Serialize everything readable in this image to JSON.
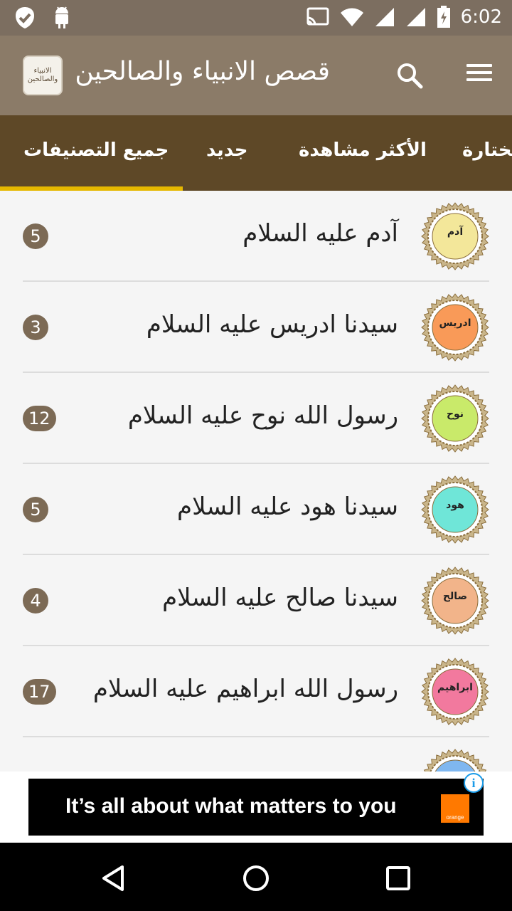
{
  "status_bar": {
    "time": "6:02",
    "left_icons": [
      "check-shield-icon",
      "android-icon"
    ],
    "right_icons": [
      "cast-icon",
      "wifi-icon",
      "signal-icon",
      "signal-icon-2",
      "battery-icon"
    ]
  },
  "toolbar": {
    "title": "قصص الانبياء والصالحين",
    "app_icon_text": "الانبياء والصالحين",
    "background": "#8b7b68"
  },
  "tabs": [
    {
      "label": "جميع التصنيفات",
      "selected": true
    },
    {
      "label": "جديد",
      "selected": false
    },
    {
      "label": "الأكثر مشاهدة",
      "selected": false
    },
    {
      "label": "مختارة",
      "selected": false
    }
  ],
  "colors": {
    "tab_bar": "#5e4827",
    "tab_indicator": "#e6b800",
    "badge": "#7c6a55"
  },
  "list": {
    "items": [
      {
        "label": "آدم عليه السلام",
        "count": "5",
        "medallion": "آدم",
        "color": "#f3e79a"
      },
      {
        "label": "سيدنا ادريس عليه السلام",
        "count": "3",
        "medallion": "ادريس",
        "color": "#f99a58"
      },
      {
        "label": "رسول الله نوح عليه السلام",
        "count": "12",
        "medallion": "نوح",
        "color": "#c9ea6a"
      },
      {
        "label": "سيدنا هود عليه السلام",
        "count": "5",
        "medallion": "هود",
        "color": "#6fe6d8"
      },
      {
        "label": "سيدنا صالح عليه السلام",
        "count": "4",
        "medallion": "صالح",
        "color": "#f2b48a"
      },
      {
        "label": "رسول الله ابراهيم عليه السلام",
        "count": "17",
        "medallion": "ابراهيم",
        "color": "#f2799e"
      },
      {
        "label": "",
        "count": "",
        "medallion": "",
        "color": "#7fb7f0"
      }
    ]
  },
  "ad": {
    "text": "It’s all about what matters to you",
    "brand": "orange",
    "info_icon": "info-icon"
  },
  "nav_bar": {
    "buttons": [
      "back-icon",
      "home-icon",
      "recents-icon"
    ]
  }
}
